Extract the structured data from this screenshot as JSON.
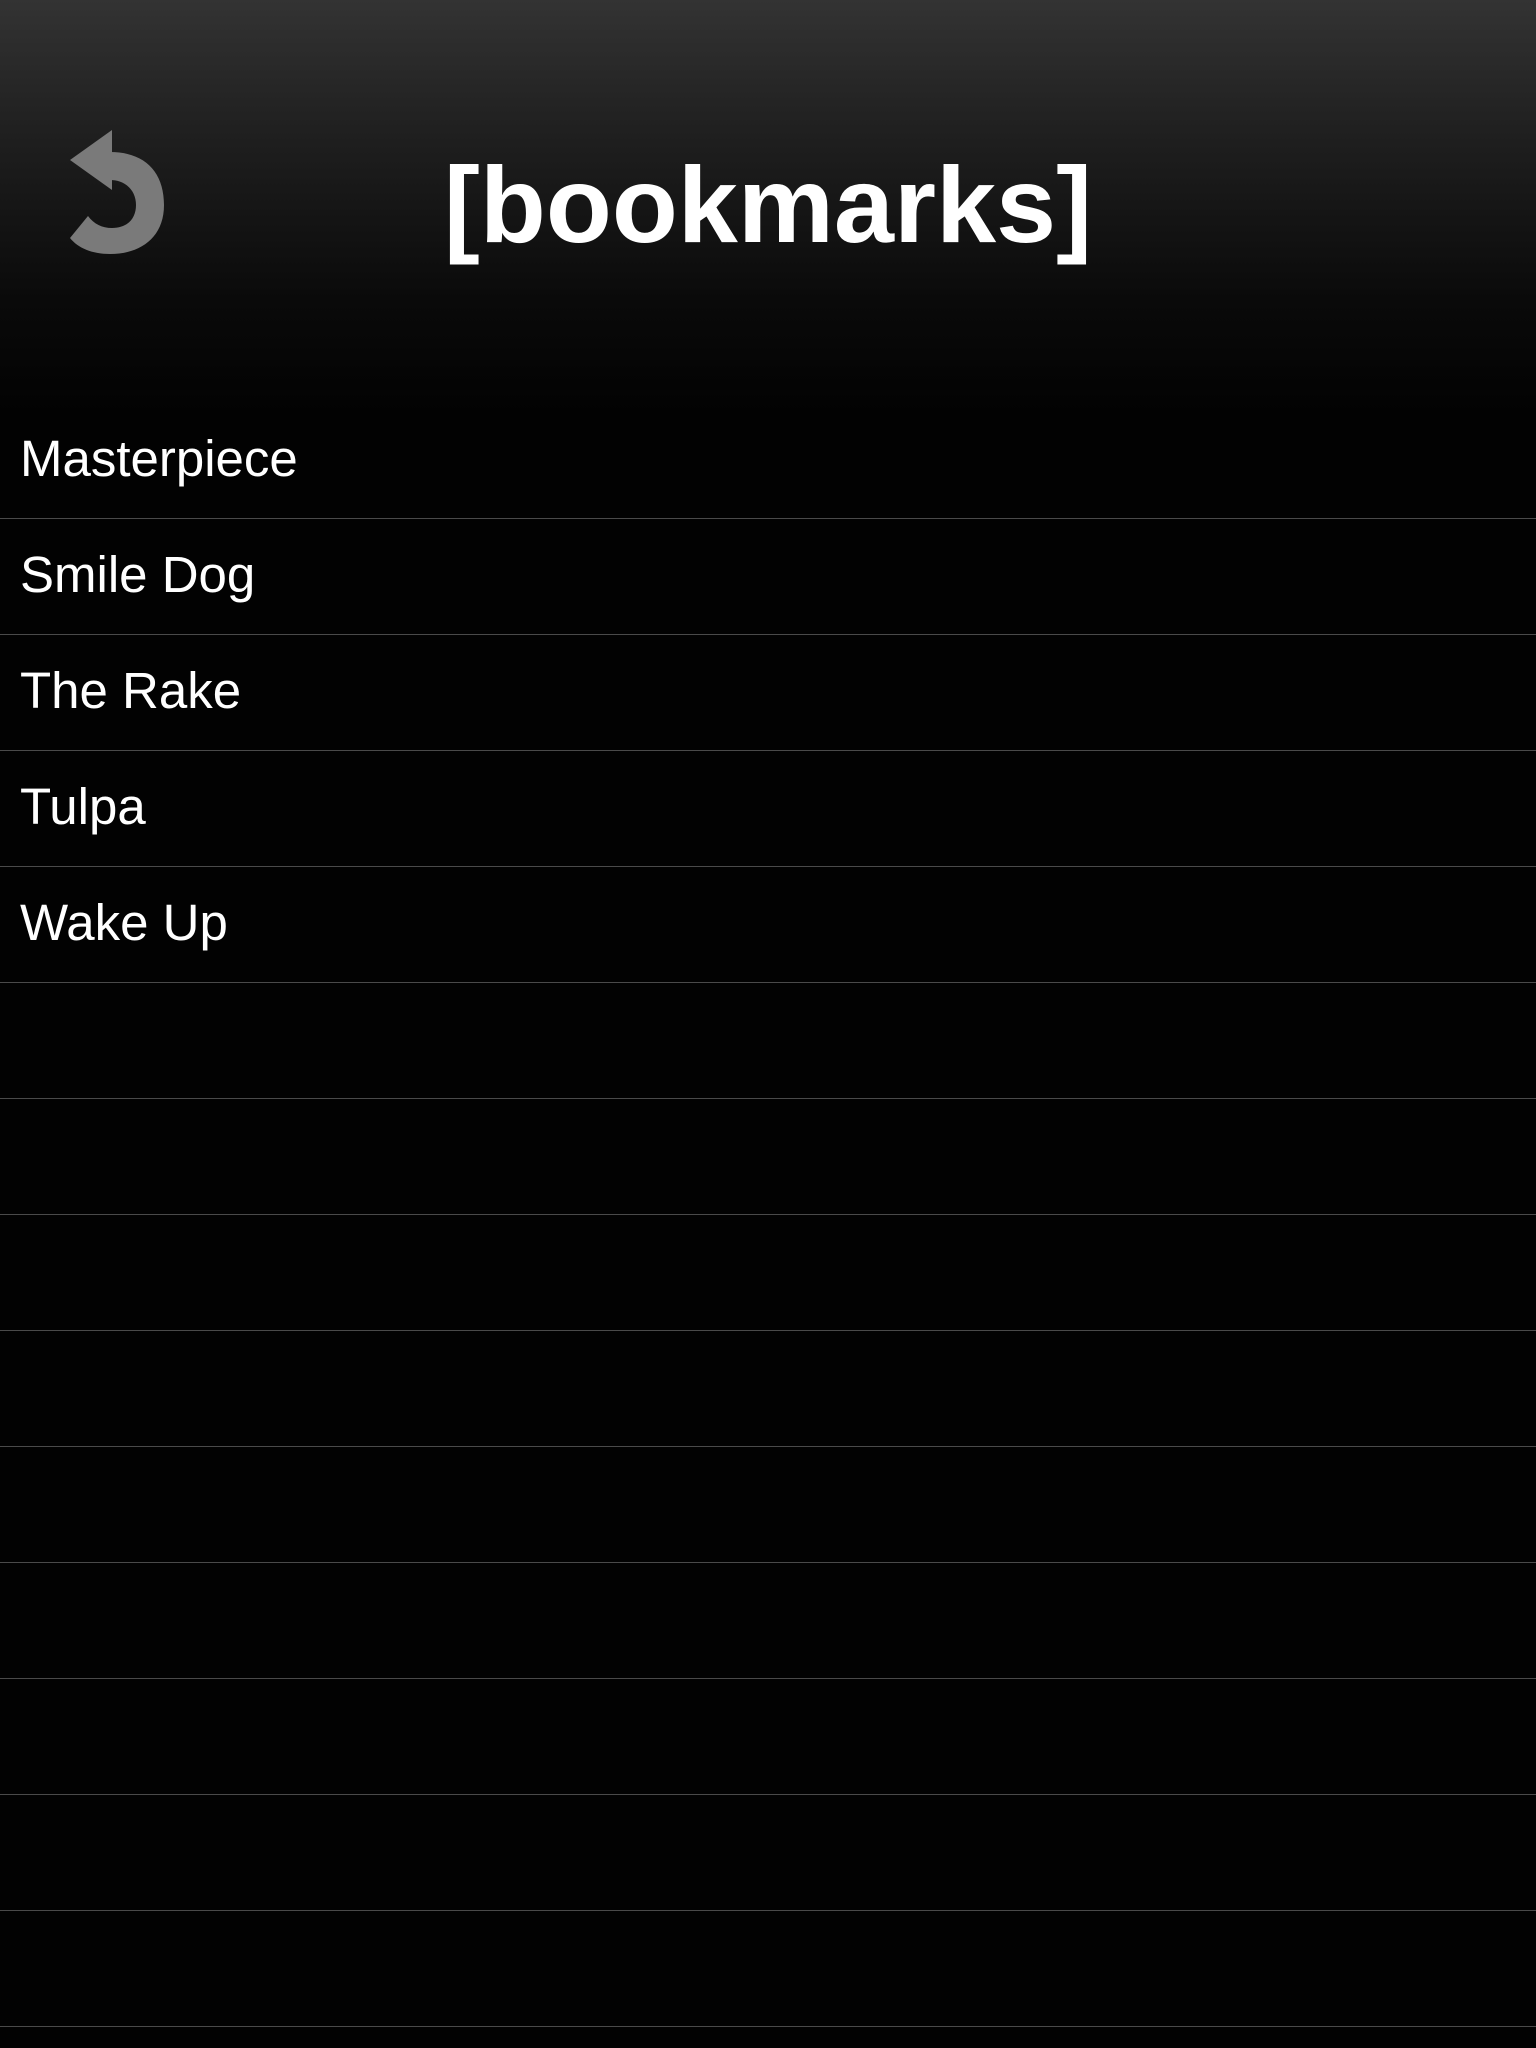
{
  "header": {
    "title": "[bookmarks]",
    "back_icon": "undo-arrow-icon",
    "back_icon_color": "#7a7a7a"
  },
  "bookmarks": {
    "items": [
      {
        "label": "Masterpiece"
      },
      {
        "label": "Smile Dog"
      },
      {
        "label": "The Rake"
      },
      {
        "label": "Tulpa"
      },
      {
        "label": "Wake Up"
      },
      {
        "label": ""
      },
      {
        "label": ""
      },
      {
        "label": ""
      },
      {
        "label": ""
      },
      {
        "label": ""
      },
      {
        "label": ""
      },
      {
        "label": ""
      },
      {
        "label": ""
      },
      {
        "label": ""
      },
      {
        "label": ""
      }
    ]
  },
  "colors": {
    "background": "#020202",
    "text": "#ffffff",
    "separator": "#4a4a4a"
  }
}
